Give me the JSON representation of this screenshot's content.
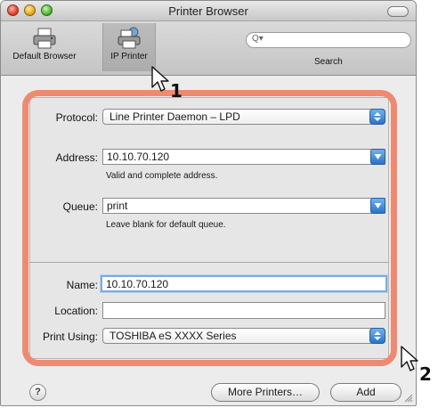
{
  "window": {
    "title": "Printer Browser"
  },
  "toolbar": {
    "default_browser_label": "Default Browser",
    "ip_printer_label": "IP Printer",
    "search_label": "Search",
    "search_placeholder": ""
  },
  "form": {
    "protocol_label": "Protocol:",
    "protocol_value": "Line Printer Daemon – LPD",
    "address_label": "Address:",
    "address_value": "10.10.70.120",
    "address_hint": "Valid and complete address.",
    "queue_label": "Queue:",
    "queue_value": "print",
    "queue_hint": "Leave blank for default queue.",
    "name_label": "Name:",
    "name_value": "10.10.70.120",
    "location_label": "Location:",
    "location_value": "",
    "print_using_label": "Print Using:",
    "print_using_value": "TOSHIBA eS XXXX Series"
  },
  "footer": {
    "help_label": "?",
    "more_printers_label": "More Printers…",
    "add_label": "Add"
  },
  "callouts": {
    "step1": "1",
    "step2": "2"
  },
  "colors": {
    "highlight_ring": "#ee8a72",
    "accent_blue": "#2a73c9"
  },
  "icons": [
    "printer-icon",
    "ip-printer-icon",
    "search-icon",
    "chevron-updown-icon",
    "chevron-down-icon",
    "help-icon",
    "resize-grip-icon",
    "cursor-arrow-icon"
  ]
}
